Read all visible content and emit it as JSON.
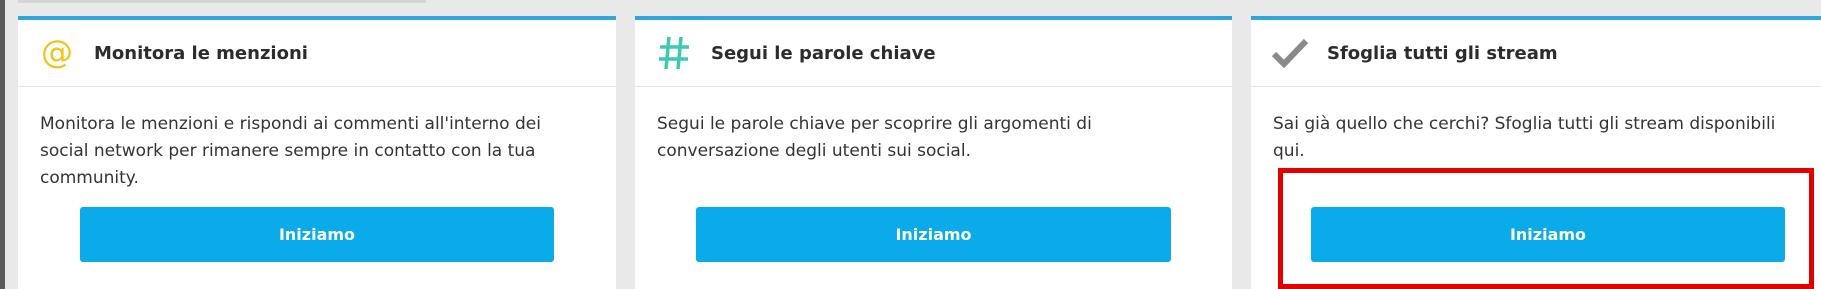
{
  "cards": [
    {
      "icon": "at-sign-icon",
      "icon_color": "#f0c419",
      "title": "Monitora le menzioni",
      "description": "Monitora le menzioni e rispondi ai commenti all'interno dei social network per rimanere sempre in contatto con la tua community.",
      "button_label": "Iniziamo"
    },
    {
      "icon": "hashtag-icon",
      "icon_color": "#3fc9b0",
      "title": "Segui le parole chiave",
      "description": "Segui le parole chiave per scoprire gli argomenti di conversazione degli utenti sui social.",
      "button_label": "Iniziamo"
    },
    {
      "icon": "checkmark-icon",
      "icon_color": "#8a8a8a",
      "title": "Sfoglia tutti gli stream",
      "description": "Sai già quello che cerchi? Sfoglia tutti gli stream disponibili qui.",
      "button_label": "Iniziamo"
    }
  ],
  "colors": {
    "accent_border": "#2fa8d8",
    "button": "#0aabe8",
    "highlight": "#e30000",
    "background": "#e9e9e9"
  }
}
